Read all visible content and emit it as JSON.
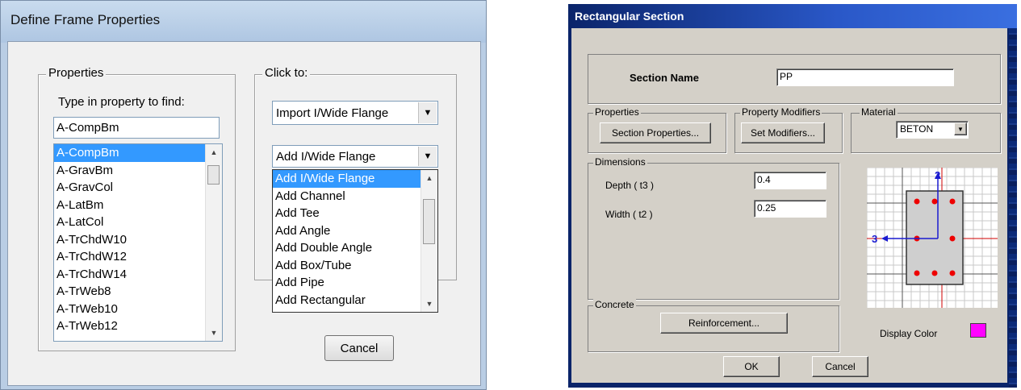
{
  "define_frame": {
    "title": "Define Frame Properties",
    "properties_group": "Properties",
    "find_label": "Type in property to find:",
    "find_value": "A-CompBm",
    "property_list": [
      "A-CompBm",
      "A-GravBm",
      "A-GravCol",
      "A-LatBm",
      "A-LatCol",
      "A-TrChdW10",
      "A-TrChdW12",
      "A-TrChdW14",
      "A-TrWeb8",
      "A-TrWeb10",
      "A-TrWeb12"
    ],
    "click_to_group": "Click to:",
    "import_combo": "Import I/Wide Flange",
    "add_combo": "Add I/Wide Flange",
    "add_options": [
      "Add I/Wide Flange",
      "Add Channel",
      "Add Tee",
      "Add Angle",
      "Add Double Angle",
      "Add Box/Tube",
      "Add Pipe",
      "Add Rectangular"
    ],
    "cancel_label": "Cancel"
  },
  "rect_section": {
    "title": "Rectangular Section",
    "section_name_label": "Section Name",
    "section_name_value": "PP",
    "properties_group": "Properties",
    "section_properties_btn": "Section Properties...",
    "modifiers_group": "Property Modifiers",
    "set_modifiers_btn": "Set Modifiers...",
    "material_group": "Material",
    "material_value": "BETON",
    "dimensions_group": "Dimensions",
    "depth_label": "Depth  ( t3 )",
    "depth_value": "0.4",
    "width_label": "Width  ( t2 )",
    "width_value": "0.25",
    "axis2_label": "2",
    "axis3_label": "3",
    "concrete_group": "Concrete",
    "reinforcement_btn": "Reinforcement...",
    "display_color_label": "Display Color",
    "display_color": "#ff00ff",
    "ok_label": "OK",
    "cancel_label": "Cancel"
  }
}
